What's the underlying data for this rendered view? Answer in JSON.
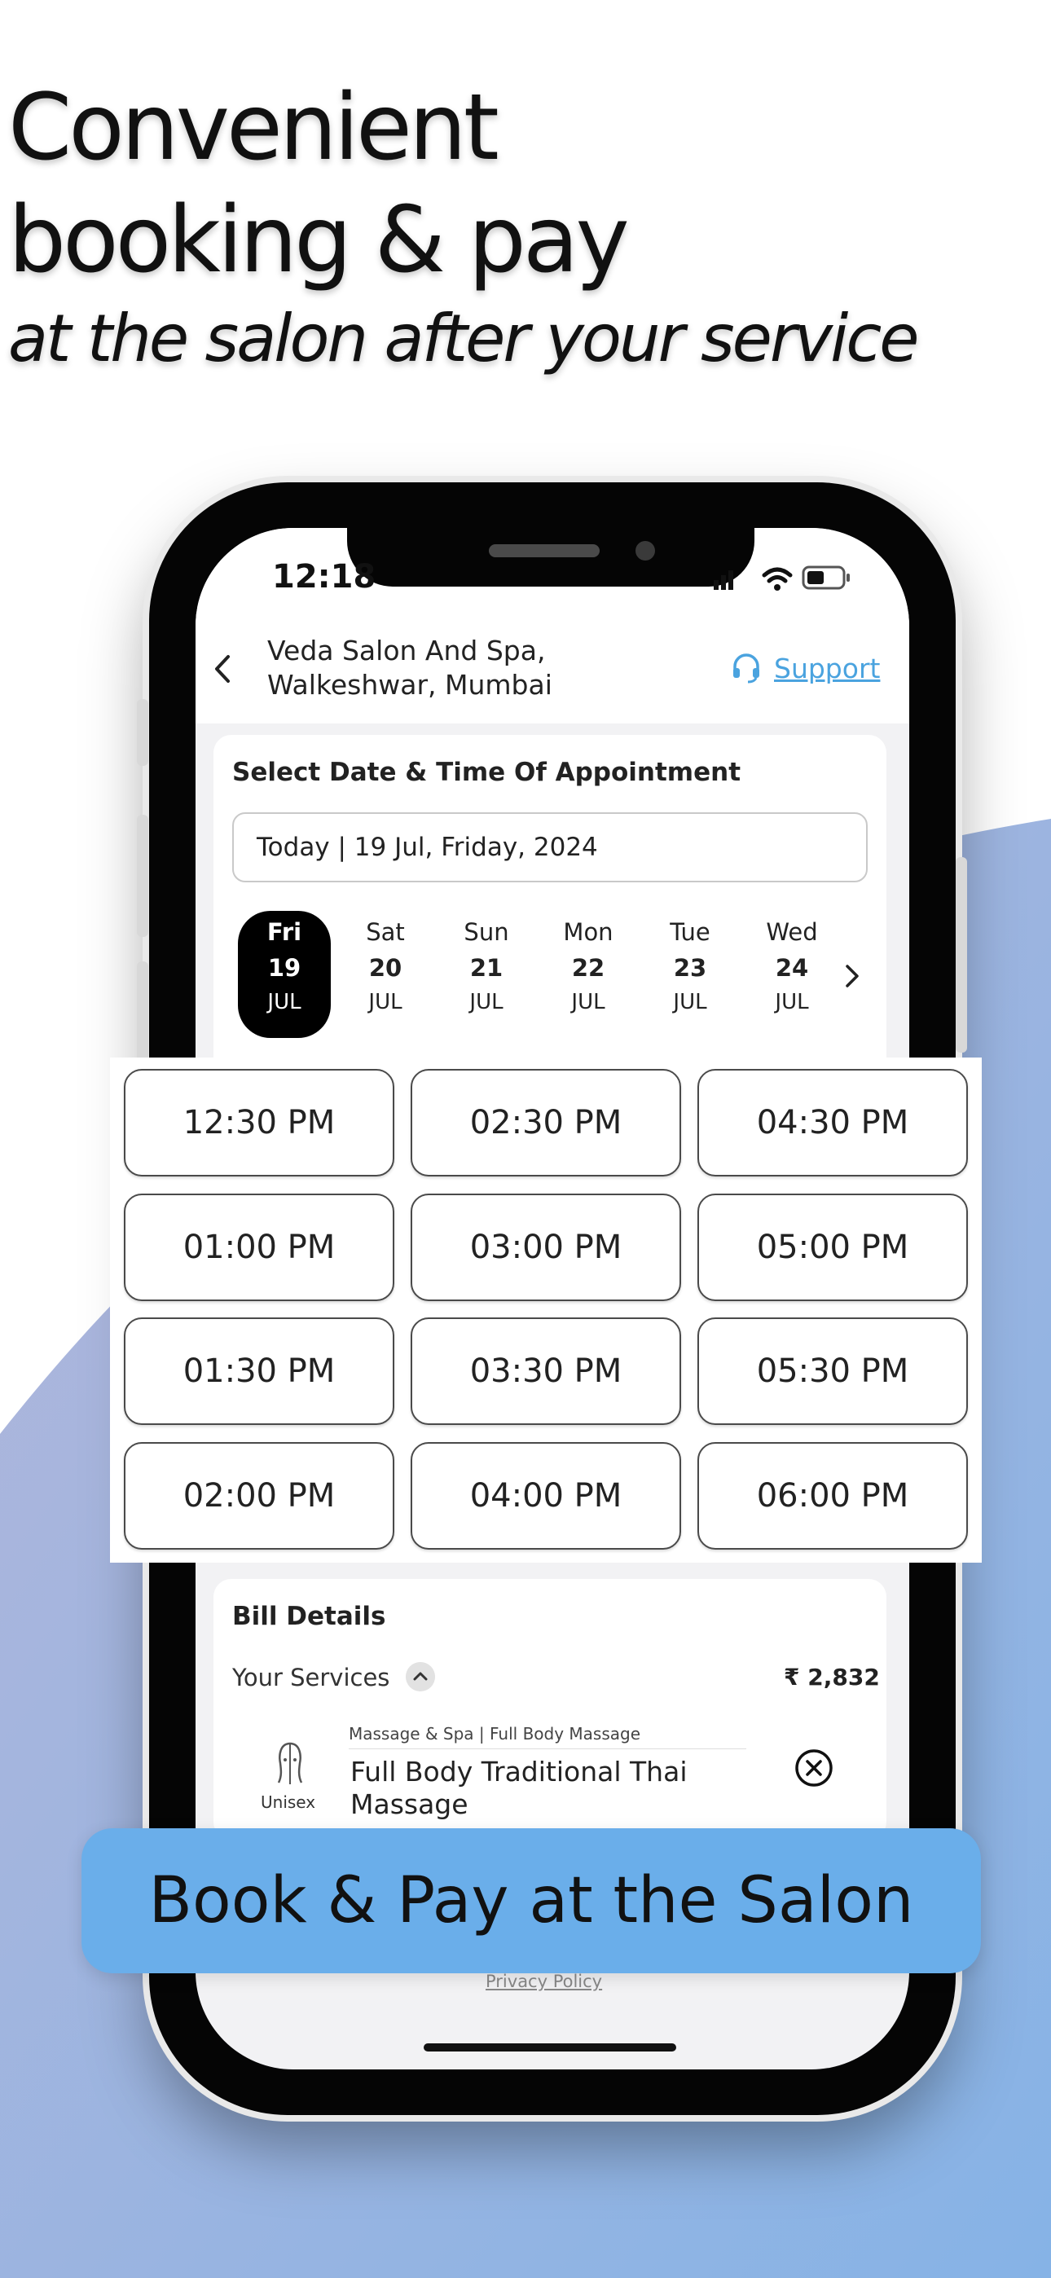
{
  "headline": {
    "line1": "Convenient",
    "line2": "booking & pay",
    "line3": "at the salon after your service"
  },
  "status_bar": {
    "time": "12:18"
  },
  "header": {
    "salon_name_line1": "Veda Salon And Spa,",
    "salon_name_line2": "Walkeshwar, Mumbai",
    "support_label": "Support"
  },
  "date_section": {
    "title": "Select Date & Time Of Appointment",
    "selected_date_text": "Today | 19 Jul, Friday, 2024",
    "days": [
      {
        "name": "Fri",
        "date": "19",
        "month": "JUL",
        "selected": true
      },
      {
        "name": "Sat",
        "date": "20",
        "month": "JUL",
        "selected": false
      },
      {
        "name": "Sun",
        "date": "21",
        "month": "JUL",
        "selected": false
      },
      {
        "name": "Mon",
        "date": "22",
        "month": "JUL",
        "selected": false
      },
      {
        "name": "Tue",
        "date": "23",
        "month": "JUL",
        "selected": false
      },
      {
        "name": "Wed",
        "date": "24",
        "month": "JUL",
        "selected": false
      }
    ]
  },
  "time_slots": [
    "12:30 PM",
    "02:30 PM",
    "04:30 PM",
    "01:00 PM",
    "03:00 PM",
    "05:00 PM",
    "01:30 PM",
    "03:30 PM",
    "05:30 PM",
    "02:00 PM",
    "04:00 PM",
    "06:00 PM"
  ],
  "bill": {
    "title": "Bill Details",
    "services_label": "Your Services",
    "services_total": "₹ 2,832",
    "service": {
      "category": "Massage & Spa | Full Body Massage",
      "name_line1": "Full Body Traditional Thai",
      "name_line2": "Massage",
      "gender_label": "Unisex"
    }
  },
  "footer": {
    "privacy_label": "Privacy Policy"
  },
  "cta_label": "Book & Pay at the Salon",
  "colors": {
    "accent": "#6aaeea",
    "support_link": "#4aa3df",
    "background_shape": "#9fb6dd"
  },
  "icons": [
    "back-chevron-icon",
    "support-headset-icon",
    "wifi-icon",
    "battery-icon",
    "signal-icon",
    "chevron-right-icon",
    "chevron-up-icon",
    "unisex-icon",
    "remove-circle-icon"
  ]
}
